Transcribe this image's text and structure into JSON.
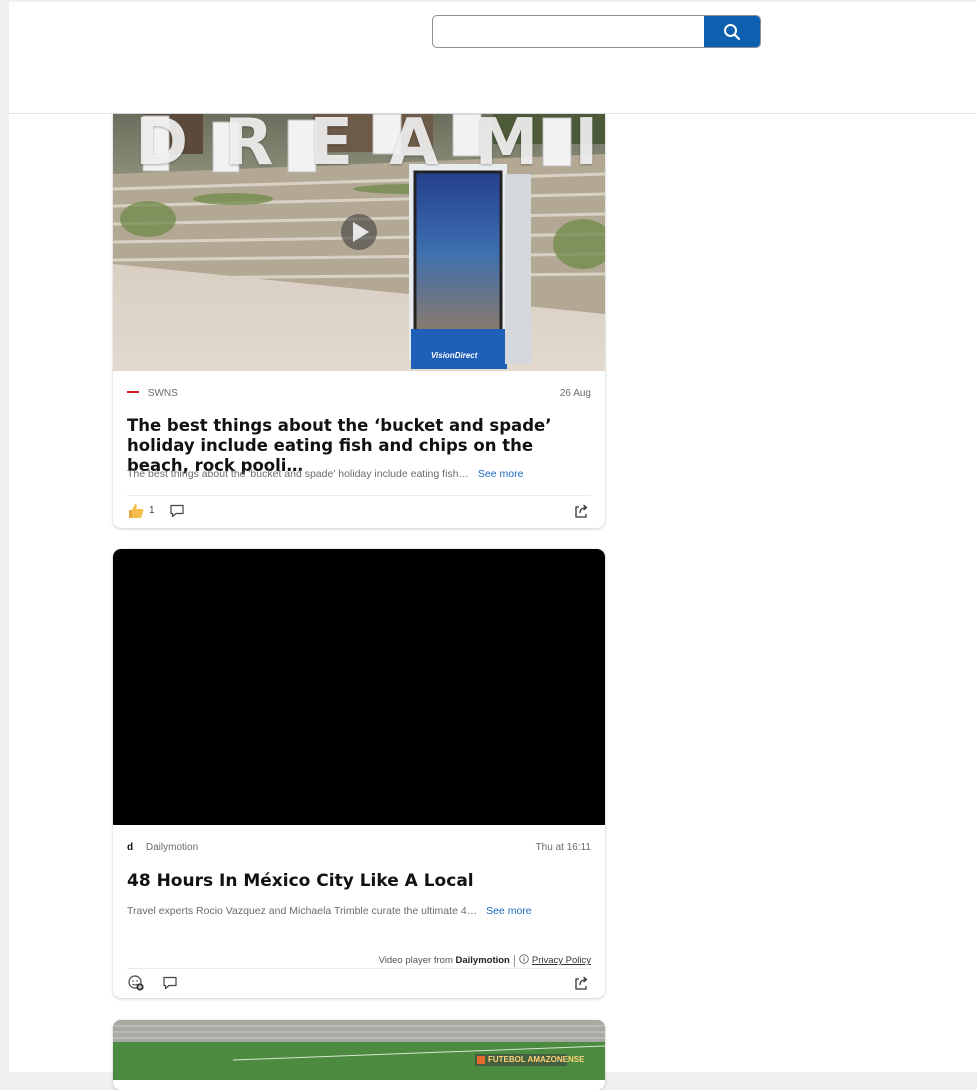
{
  "search": {
    "value": "",
    "placeholder": "",
    "icon": "search-icon"
  },
  "cards": [
    {
      "source": "SWNS",
      "date": "26 Aug",
      "title": "The best things about the ‘bucket and spade’ holiday include eating fish and chips on the beach, rock pooli…",
      "snippet": "The best things about the 'bucket and spade' holiday include eating fish…",
      "see_more": "See more",
      "image_text": "DREAMI",
      "kiosk_brand": "VisionDirect",
      "like_count": "1"
    },
    {
      "source_logo": "d",
      "source": "Dailymotion",
      "date": "Thu at 16:11",
      "title": "48 Hours In México City Like A Local",
      "snippet": "Travel experts Rocio Vazquez and Michaela Trimble curate the ultimate 4…",
      "see_more": "See more",
      "attribution_prefix": "Video player from",
      "attribution_brand": "Dailymotion",
      "privacy_label": "Privacy Policy"
    },
    {
      "watermark": "FUTEBOL AMAZONENSE"
    }
  ],
  "colors": {
    "accent": "#0d5fb0",
    "link": "#1a69c2",
    "swns_red": "#d4212e"
  }
}
